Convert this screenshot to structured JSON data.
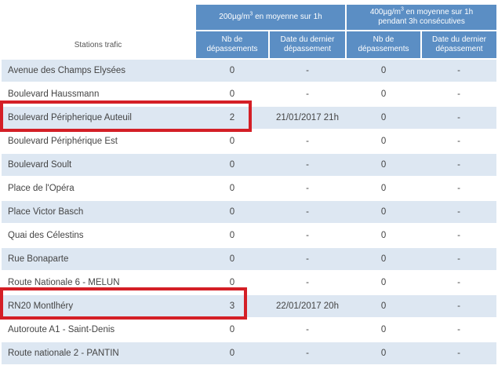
{
  "header": {
    "group1": {
      "pre": "200µg/m",
      "sup": "3",
      "post": " en moyenne sur 1h"
    },
    "group2": {
      "pre": "400µg/m",
      "sup": "3",
      "post": " en moyenne sur 1h",
      "line2": "pendant 3h consécutives"
    },
    "stations_label": "Stations trafic",
    "nb_line1": "Nb de",
    "nb_line2": "dépassements",
    "date_line1": "Date du dernier",
    "date_line2": "dépassement"
  },
  "rows": [
    {
      "station": "Avenue des Champs Elysées",
      "nb1": "0",
      "date1": "-",
      "nb2": "0",
      "date2": "-"
    },
    {
      "station": "Boulevard Haussmann",
      "nb1": "0",
      "date1": "-",
      "nb2": "0",
      "date2": "-"
    },
    {
      "station": "Boulevard Péripherique Auteuil",
      "nb1": "2",
      "date1": "21/01/2017 21h",
      "nb2": "0",
      "date2": "-"
    },
    {
      "station": "Boulevard Périphérique Est",
      "nb1": "0",
      "date1": "-",
      "nb2": "0",
      "date2": "-"
    },
    {
      "station": "Boulevard Soult",
      "nb1": "0",
      "date1": "-",
      "nb2": "0",
      "date2": "-"
    },
    {
      "station": "Place de l'Opéra",
      "nb1": "0",
      "date1": "-",
      "nb2": "0",
      "date2": "-"
    },
    {
      "station": "Place Victor Basch",
      "nb1": "0",
      "date1": "-",
      "nb2": "0",
      "date2": "-"
    },
    {
      "station": "Quai des Célestins",
      "nb1": "0",
      "date1": "-",
      "nb2": "0",
      "date2": "-"
    },
    {
      "station": "Rue Bonaparte",
      "nb1": "0",
      "date1": "-",
      "nb2": "0",
      "date2": "-"
    },
    {
      "station": "Route Nationale 6 - MELUN",
      "nb1": "0",
      "date1": "-",
      "nb2": "0",
      "date2": "-"
    },
    {
      "station": "RN20 Montlhéry",
      "nb1": "3",
      "date1": "22/01/2017 20h",
      "nb2": "0",
      "date2": "-"
    },
    {
      "station": "Autoroute A1 - Saint-Denis",
      "nb1": "0",
      "date1": "-",
      "nb2": "0",
      "date2": "-"
    },
    {
      "station": "Route nationale 2 - PANTIN",
      "nb1": "0",
      "date1": "-",
      "nb2": "0",
      "date2": "-"
    }
  ],
  "highlight_color": "#d41f26"
}
